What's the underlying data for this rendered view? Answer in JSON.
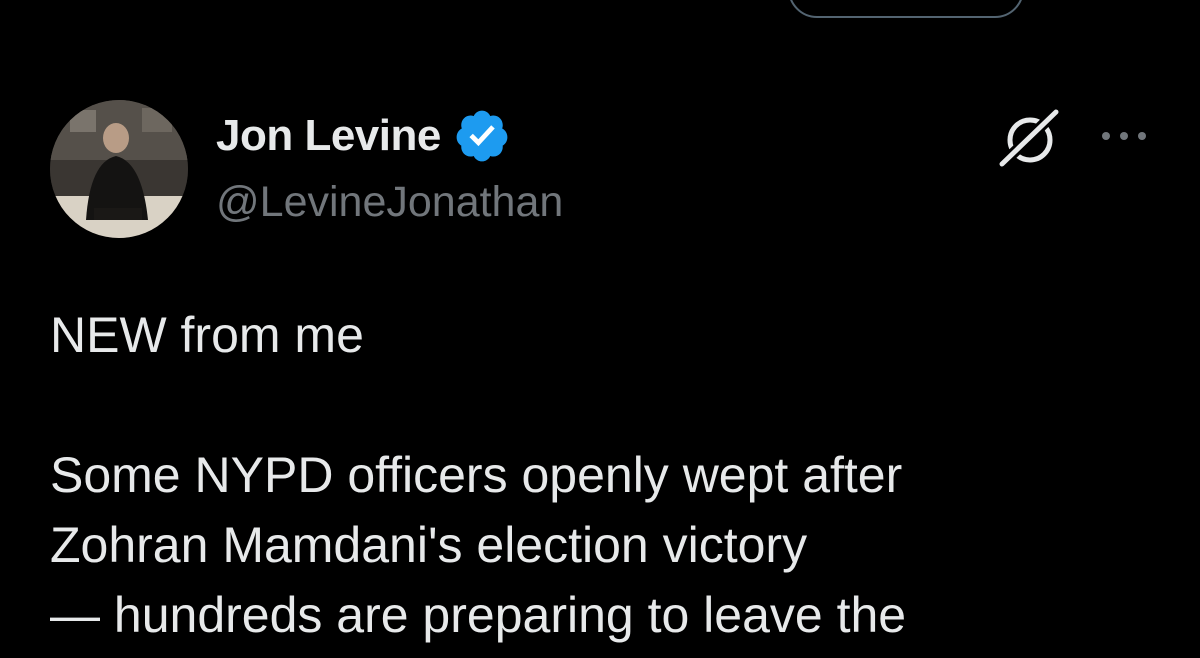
{
  "tweet": {
    "author": {
      "display_name": "Jon Levine",
      "handle": "@LevineJonathan",
      "verified": true,
      "verified_color": "#1d9bf0"
    },
    "text_lines": [
      "NEW from me",
      "",
      "Some NYPD officers openly wept after",
      "Zohran Mamdani's election victory",
      "— hundreds are preparing to leave the"
    ]
  },
  "icons": {
    "grok": "grok-icon",
    "more": "more-options-icon",
    "verified": "verified-badge-icon"
  },
  "colors": {
    "background": "#000000",
    "primary_text": "#e7e9ea",
    "secondary_text": "#71767b",
    "border": "#536471"
  }
}
